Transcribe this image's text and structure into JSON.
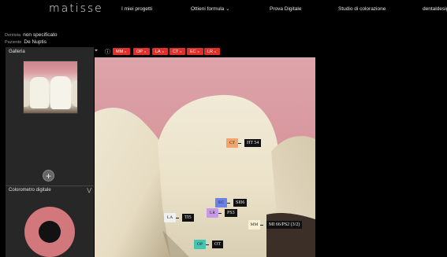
{
  "brand": {
    "logo": "matisse"
  },
  "nav": {
    "items": [
      {
        "label": "I miei progetti"
      },
      {
        "label": "Ottieni formula",
        "chevron": "chevron-down-icon"
      },
      {
        "label": "Prova Digitale"
      },
      {
        "label": "Studio di colorazione"
      },
      {
        "label": "dentaldesig"
      }
    ]
  },
  "patient": {
    "dentist_key": "Dentista",
    "dentist_value": "non specificato",
    "patient_key": "Paziente",
    "patient_value": "De Nuptis"
  },
  "sidebar": {
    "gallery_title": "Galleria",
    "add_label": "+",
    "colorimeter_title": "Colorometro digitale",
    "colorimeter_chevron": "chevrons-down-icon",
    "ring_color": "#d2777b"
  },
  "toolbar": {
    "crop_icon": "crop-icon",
    "info_icon": "info-icon",
    "chips": [
      {
        "label": "MM",
        "close": "x"
      },
      {
        "label": "OP",
        "close": "x"
      },
      {
        "label": "LA",
        "close": "x"
      },
      {
        "label": "CT",
        "close": "x"
      },
      {
        "label": "EC",
        "close": "x"
      },
      {
        "label": "LR",
        "close": "x"
      }
    ],
    "chip_color": "#e0302a"
  },
  "shades": [
    {
      "code": "CT",
      "value": "HT 54",
      "color": "#f2a46a"
    },
    {
      "code": "EC",
      "value": "SI06",
      "color": "#6a82e6"
    },
    {
      "code": "LR",
      "value": "PS3",
      "color": "#c79ae6"
    },
    {
      "code": "LA",
      "value": "TI5",
      "color": "#f0f0f0"
    },
    {
      "code": "MM",
      "value": "MI 66/PS2 (3/2)",
      "color": "#f6f0d6"
    },
    {
      "code": "OP",
      "value": "OT",
      "color": "#45c4b4"
    }
  ]
}
